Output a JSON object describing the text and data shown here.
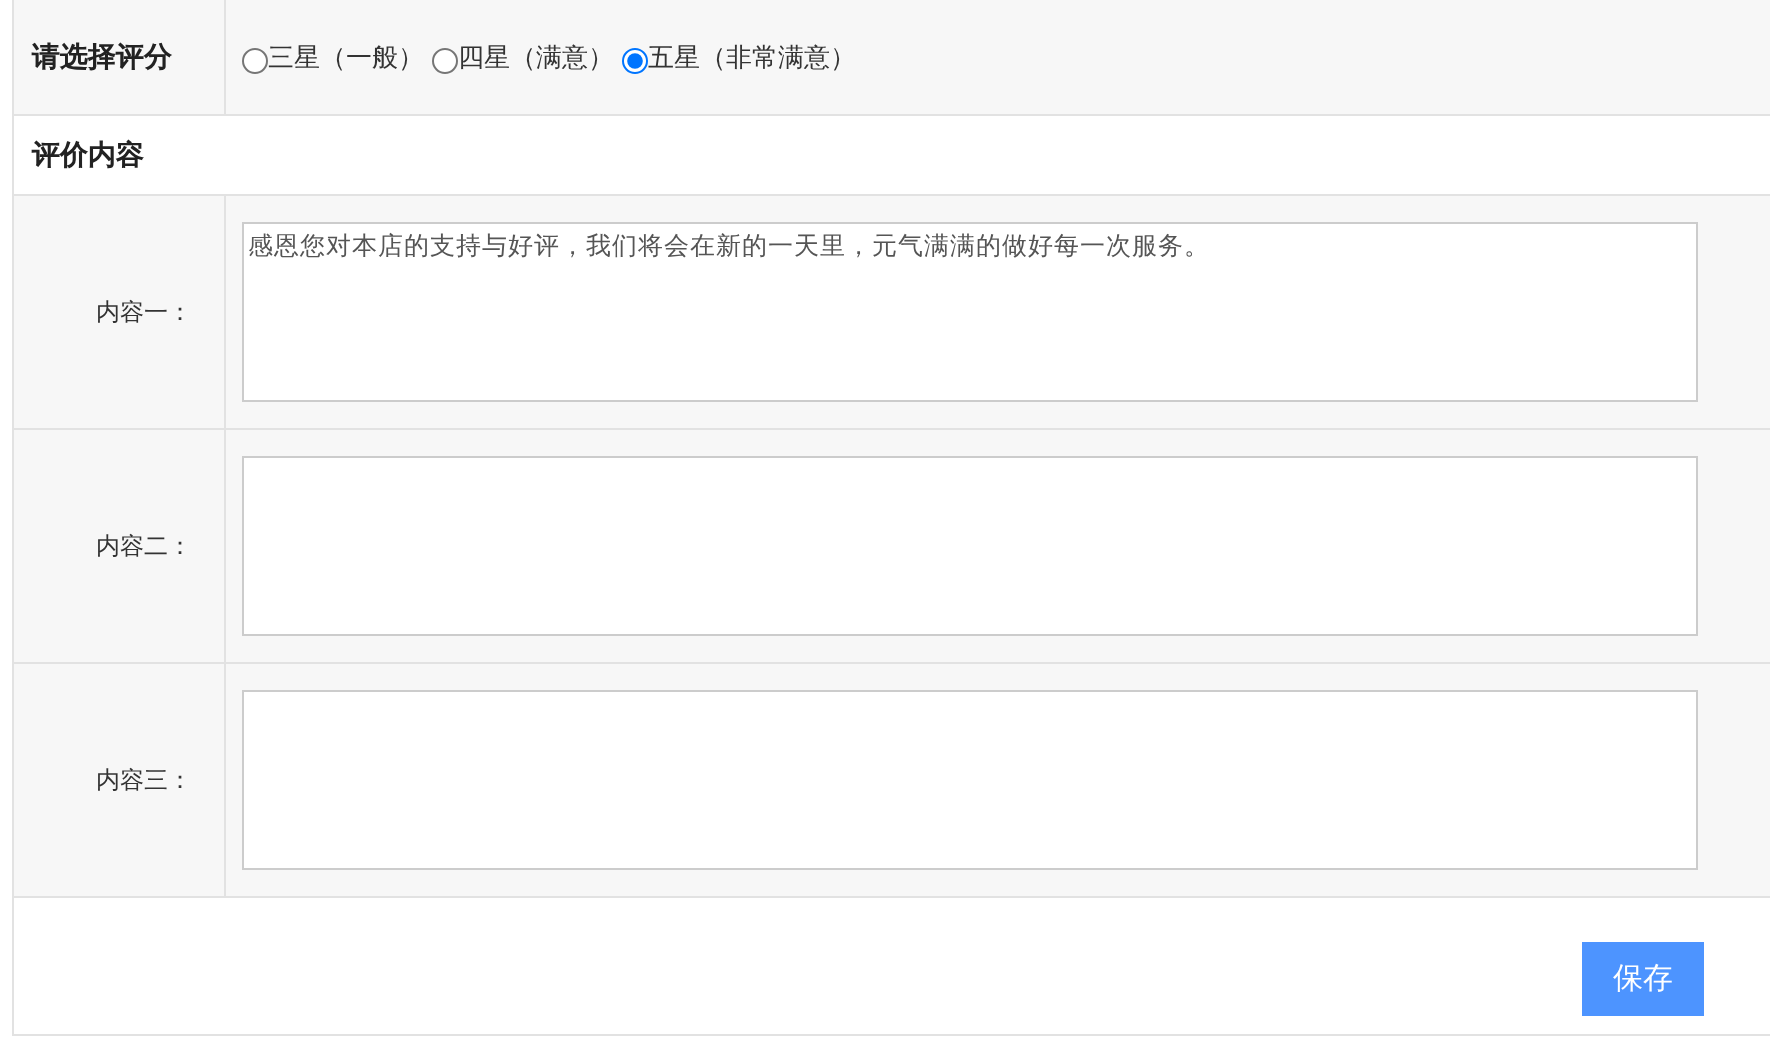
{
  "rating": {
    "label": "请选择评分",
    "options": [
      {
        "text": "三星（一般）",
        "selected": false
      },
      {
        "text": "四星（满意）",
        "selected": false
      },
      {
        "text": "五星（非常满意）",
        "selected": true
      }
    ]
  },
  "section_title": "评价内容",
  "contents": [
    {
      "label": "内容一：",
      "value": "感恩您对本店的支持与好评，我们将会在新的一天里，元气满满的做好每一次服务。"
    },
    {
      "label": "内容二："
    },
    {
      "label": "内容三："
    }
  ],
  "save_button": "保存"
}
